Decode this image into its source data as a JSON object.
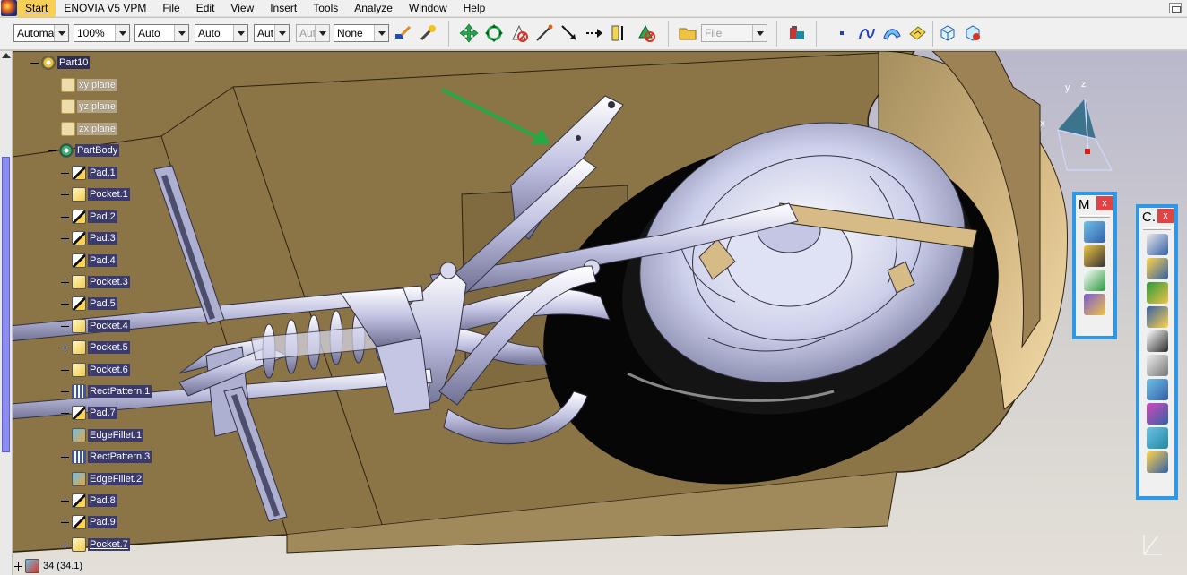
{
  "menubar": {
    "items": [
      "Start",
      "ENOVIA V5 VPM",
      "File",
      "Edit",
      "View",
      "Insert",
      "Tools",
      "Analyze",
      "Window",
      "Help"
    ]
  },
  "toolbar": {
    "combos": {
      "render_style": "Automa",
      "zoom": "100%",
      "line_type": "Auto",
      "line_weight": "Auto",
      "layer_a": "Aut",
      "layer_b": "Aut",
      "pattern": "None",
      "file": "File"
    }
  },
  "tree": {
    "root": "Part10",
    "planes": [
      "xy plane",
      "yz plane",
      "zx plane"
    ],
    "body": "PartBody",
    "features": [
      {
        "label": "Pad.1",
        "kind": "pad"
      },
      {
        "label": "Pocket.1",
        "kind": "pocket"
      },
      {
        "label": "Pad.2",
        "kind": "pad"
      },
      {
        "label": "Pad.3",
        "kind": "pad"
      },
      {
        "label": "Pad.4",
        "kind": "pad"
      },
      {
        "label": "Pocket.3",
        "kind": "pocket"
      },
      {
        "label": "Pad.5",
        "kind": "pad"
      },
      {
        "label": "Pocket.4",
        "kind": "pocket"
      },
      {
        "label": "Pocket.5",
        "kind": "pocket"
      },
      {
        "label": "Pocket.6",
        "kind": "pocket"
      },
      {
        "label": "RectPattern.1",
        "kind": "pattern"
      },
      {
        "label": "Pad.7",
        "kind": "pad"
      },
      {
        "label": "EdgeFillet.1",
        "kind": "fillet"
      },
      {
        "label": "RectPattern.3",
        "kind": "pattern"
      },
      {
        "label": "EdgeFillet.2",
        "kind": "fillet"
      },
      {
        "label": "Pad.8",
        "kind": "pad"
      },
      {
        "label": "Pad.9",
        "kind": "pad"
      },
      {
        "label": "Pocket.7",
        "kind": "pocket"
      }
    ],
    "footer_value": "34 (34.1)"
  },
  "compass": {
    "x": "x",
    "y": "y",
    "z": "z"
  },
  "float_toolbars": {
    "m": {
      "title": "M",
      "close": "x"
    },
    "c": {
      "title": "C.",
      "close": "x"
    }
  },
  "colors": {
    "accent": "#2e97e6",
    "selection": "#3a3a6e",
    "part_tan": "#8b7446"
  }
}
